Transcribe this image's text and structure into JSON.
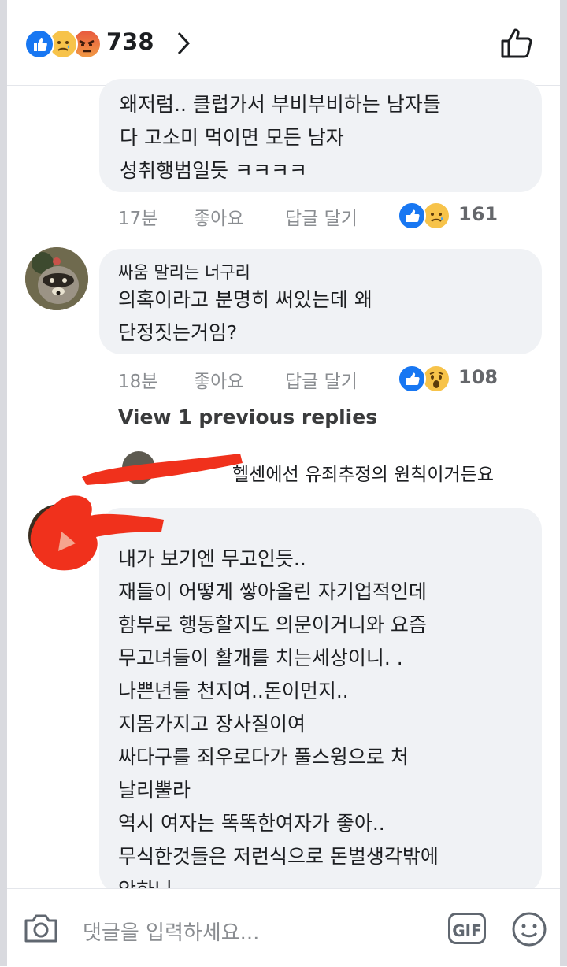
{
  "header": {
    "reaction_count": "738",
    "reactions": [
      "like-icon",
      "sad-icon",
      "angry-icon"
    ]
  },
  "comments": [
    {
      "author": "",
      "lines": [
        "왜저럼.. 클럽가서 부비부비하는 남자들",
        "다 고소미 먹이면 모든 남자",
        "성취행범일듯 ㅋㅋㅋㅋ"
      ],
      "time": "17분",
      "like_label": "좋아요",
      "reply_label": "답글 달기",
      "reaction_count": "161",
      "reactions": [
        "like-icon",
        "sad-icon"
      ]
    },
    {
      "author": "싸움 말리는 너구리",
      "lines": [
        "의혹이라고 분명히 써있는데 왜",
        "단정짓는거임?"
      ],
      "time": "18분",
      "like_label": "좋아요",
      "reply_label": "답글 달기",
      "reaction_count": "108",
      "reactions": [
        "like-icon",
        "wow-icon"
      ]
    },
    {
      "author": "",
      "lines": [
        "내가 보기엔 무고인듯..",
        "재들이 어떻게 쌓아올린 자기업적인데",
        "함부로 행동할지도 의문이거니와  요즘",
        "무고녀들이 활개를 치는세상이니. .",
        "나쁜년들 천지여..돈이먼지..",
        "지몸가지고 장사질이여",
        "싸다구를 죄우로다가 풀스윙으로 처",
        "날리뿔라",
        "역시 여자는 똑똑한여자가 좋아..",
        "무식한것들은 저런식으로 돈벌생각밖에",
        "안하니"
      ]
    }
  ],
  "view_previous": "View 1 previous replies",
  "reply_preview": "헬센에선 유죄추정의 원칙이거든요",
  "composer": {
    "placeholder": "댓글을 입력하세요...",
    "gif_label": "GIF"
  },
  "colors": {
    "like_blue": "#1877f2",
    "bubble_bg": "#f0f2f5",
    "meta_gray": "#8a8d91",
    "redaction_red": "#f0311c"
  }
}
